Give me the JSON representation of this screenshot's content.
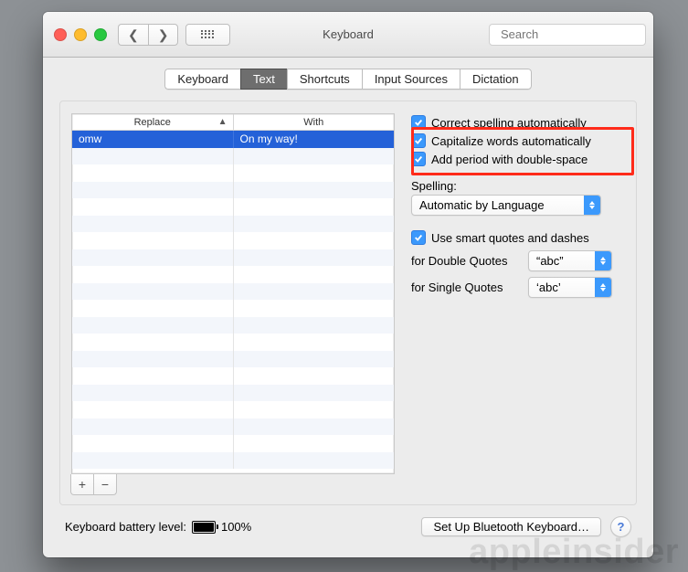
{
  "header": {
    "title": "Keyboard",
    "search_placeholder": "Search"
  },
  "tabs": [
    {
      "label": "Keyboard"
    },
    {
      "label": "Text"
    },
    {
      "label": "Shortcuts"
    },
    {
      "label": "Input Sources"
    },
    {
      "label": "Dictation"
    }
  ],
  "active_tab": "Text",
  "table": {
    "col1": "Replace",
    "col2": "With",
    "rows": [
      {
        "replace": "omw",
        "with": "On my way!"
      }
    ]
  },
  "options": {
    "correct_spelling": "Correct spelling automatically",
    "capitalize": "Capitalize words automatically",
    "period": "Add period with double-space",
    "spelling_label": "Spelling:",
    "spelling_value": "Automatic by Language",
    "smart_quotes": "Use smart quotes and dashes",
    "double_quotes_label": "for Double Quotes",
    "double_quotes_value": "“abc”",
    "single_quotes_label": "for Single Quotes",
    "single_quotes_value": "‘abc’"
  },
  "footer": {
    "battery_label": "Keyboard battery level:",
    "battery_pct": "100%",
    "bluetooth_button": "Set Up Bluetooth Keyboard…"
  },
  "watermark": "appleinsider"
}
